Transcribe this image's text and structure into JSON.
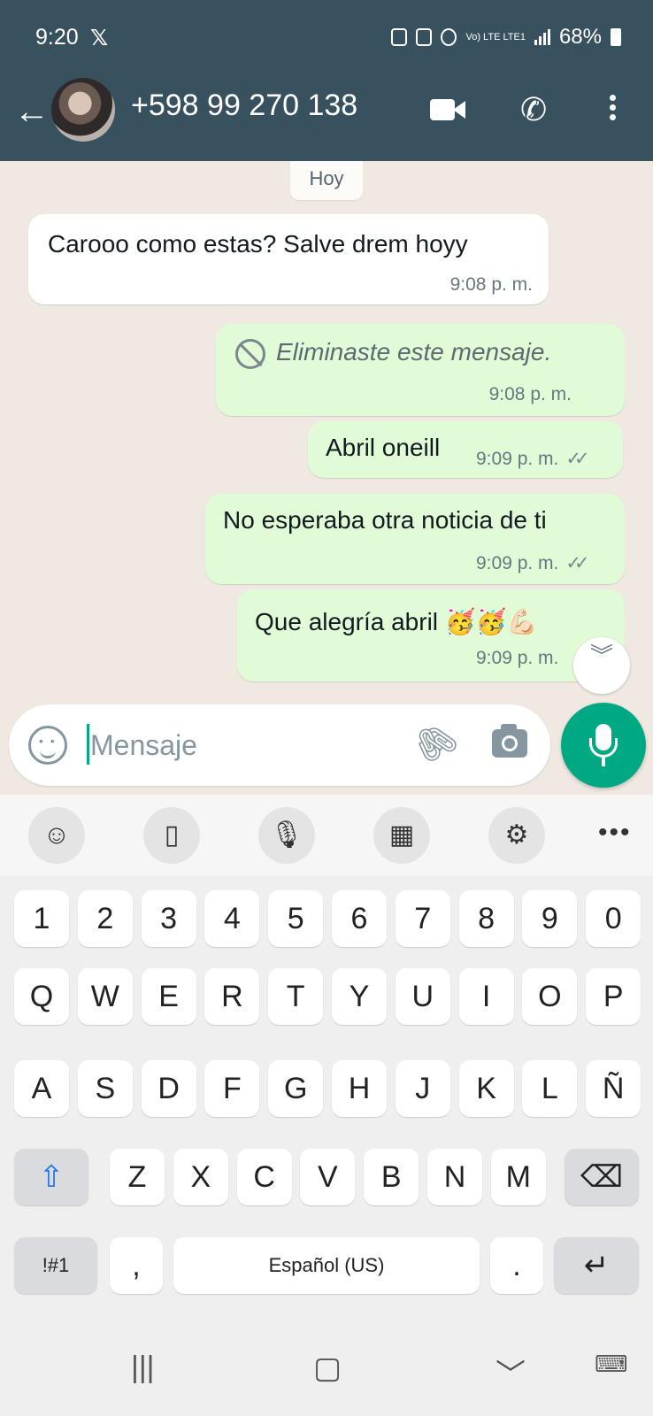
{
  "status_bar": {
    "time": "9:20",
    "app_icon": "x-logo",
    "network_label": "Vo) LTE LTE1",
    "battery": "68%"
  },
  "header": {
    "back_icon": "arrow-left-icon",
    "contact_name": "+598 99 270 138",
    "actions": [
      "video-call-icon",
      "phone-icon",
      "more-vert-icon"
    ]
  },
  "chat": {
    "date_chip": "Hoy",
    "messages": [
      {
        "direction": "in",
        "text": "Carooo como estas? Salve drem hoyy",
        "time": "9:08 p. m."
      },
      {
        "direction": "out",
        "deleted": true,
        "text": "Eliminaste este mensaje.",
        "time": "9:08 p. m."
      },
      {
        "direction": "out",
        "text": "Abril oneill",
        "time": "9:09 p. m.",
        "read_ticks": "✓✓"
      },
      {
        "direction": "out",
        "text": "No esperaba otra noticia de ti",
        "time": "9:09 p. m.",
        "read_ticks": "✓✓"
      },
      {
        "direction": "out",
        "text": "Que alegría abril 🥳🥳💪🏻",
        "time": "9:09 p. m."
      }
    ],
    "scroll_down_icon": "double-chevron-down-icon"
  },
  "composer": {
    "placeholder": "Mensaje",
    "emoji_icon": "smiley-icon",
    "attach_icon": "paperclip-icon",
    "camera_icon": "camera-icon",
    "mic_icon": "microphone-icon"
  },
  "keyboard": {
    "toolbar": [
      "emoji-icon",
      "clipboard-icon",
      "voice-input-icon",
      "keypad-icon",
      "settings-icon",
      "more-icon"
    ],
    "rows": [
      [
        "1",
        "2",
        "3",
        "4",
        "5",
        "6",
        "7",
        "8",
        "9",
        "0"
      ],
      [
        "Q",
        "W",
        "E",
        "R",
        "T",
        "Y",
        "U",
        "I",
        "O",
        "P"
      ],
      [
        "A",
        "S",
        "D",
        "F",
        "G",
        "H",
        "J",
        "K",
        "L",
        "Ñ"
      ],
      [
        "Z",
        "X",
        "C",
        "V",
        "B",
        "N",
        "M"
      ]
    ],
    "symbols_key": "!#1",
    "comma_key": ",",
    "space_label": "Español (US)",
    "period_key": ".",
    "shift_icon": "shift-icon",
    "backspace_icon": "backspace-icon",
    "enter_icon": "enter-icon"
  },
  "nav_bar": {
    "buttons": [
      "recents-icon",
      "home-icon",
      "back-down-icon",
      "keyboard-switch-icon"
    ]
  },
  "colors": {
    "header_bg": "#37515f",
    "outgoing_bubble": "#e2fbd7",
    "incoming_bubble": "#ffffff",
    "accent": "#00a884"
  }
}
